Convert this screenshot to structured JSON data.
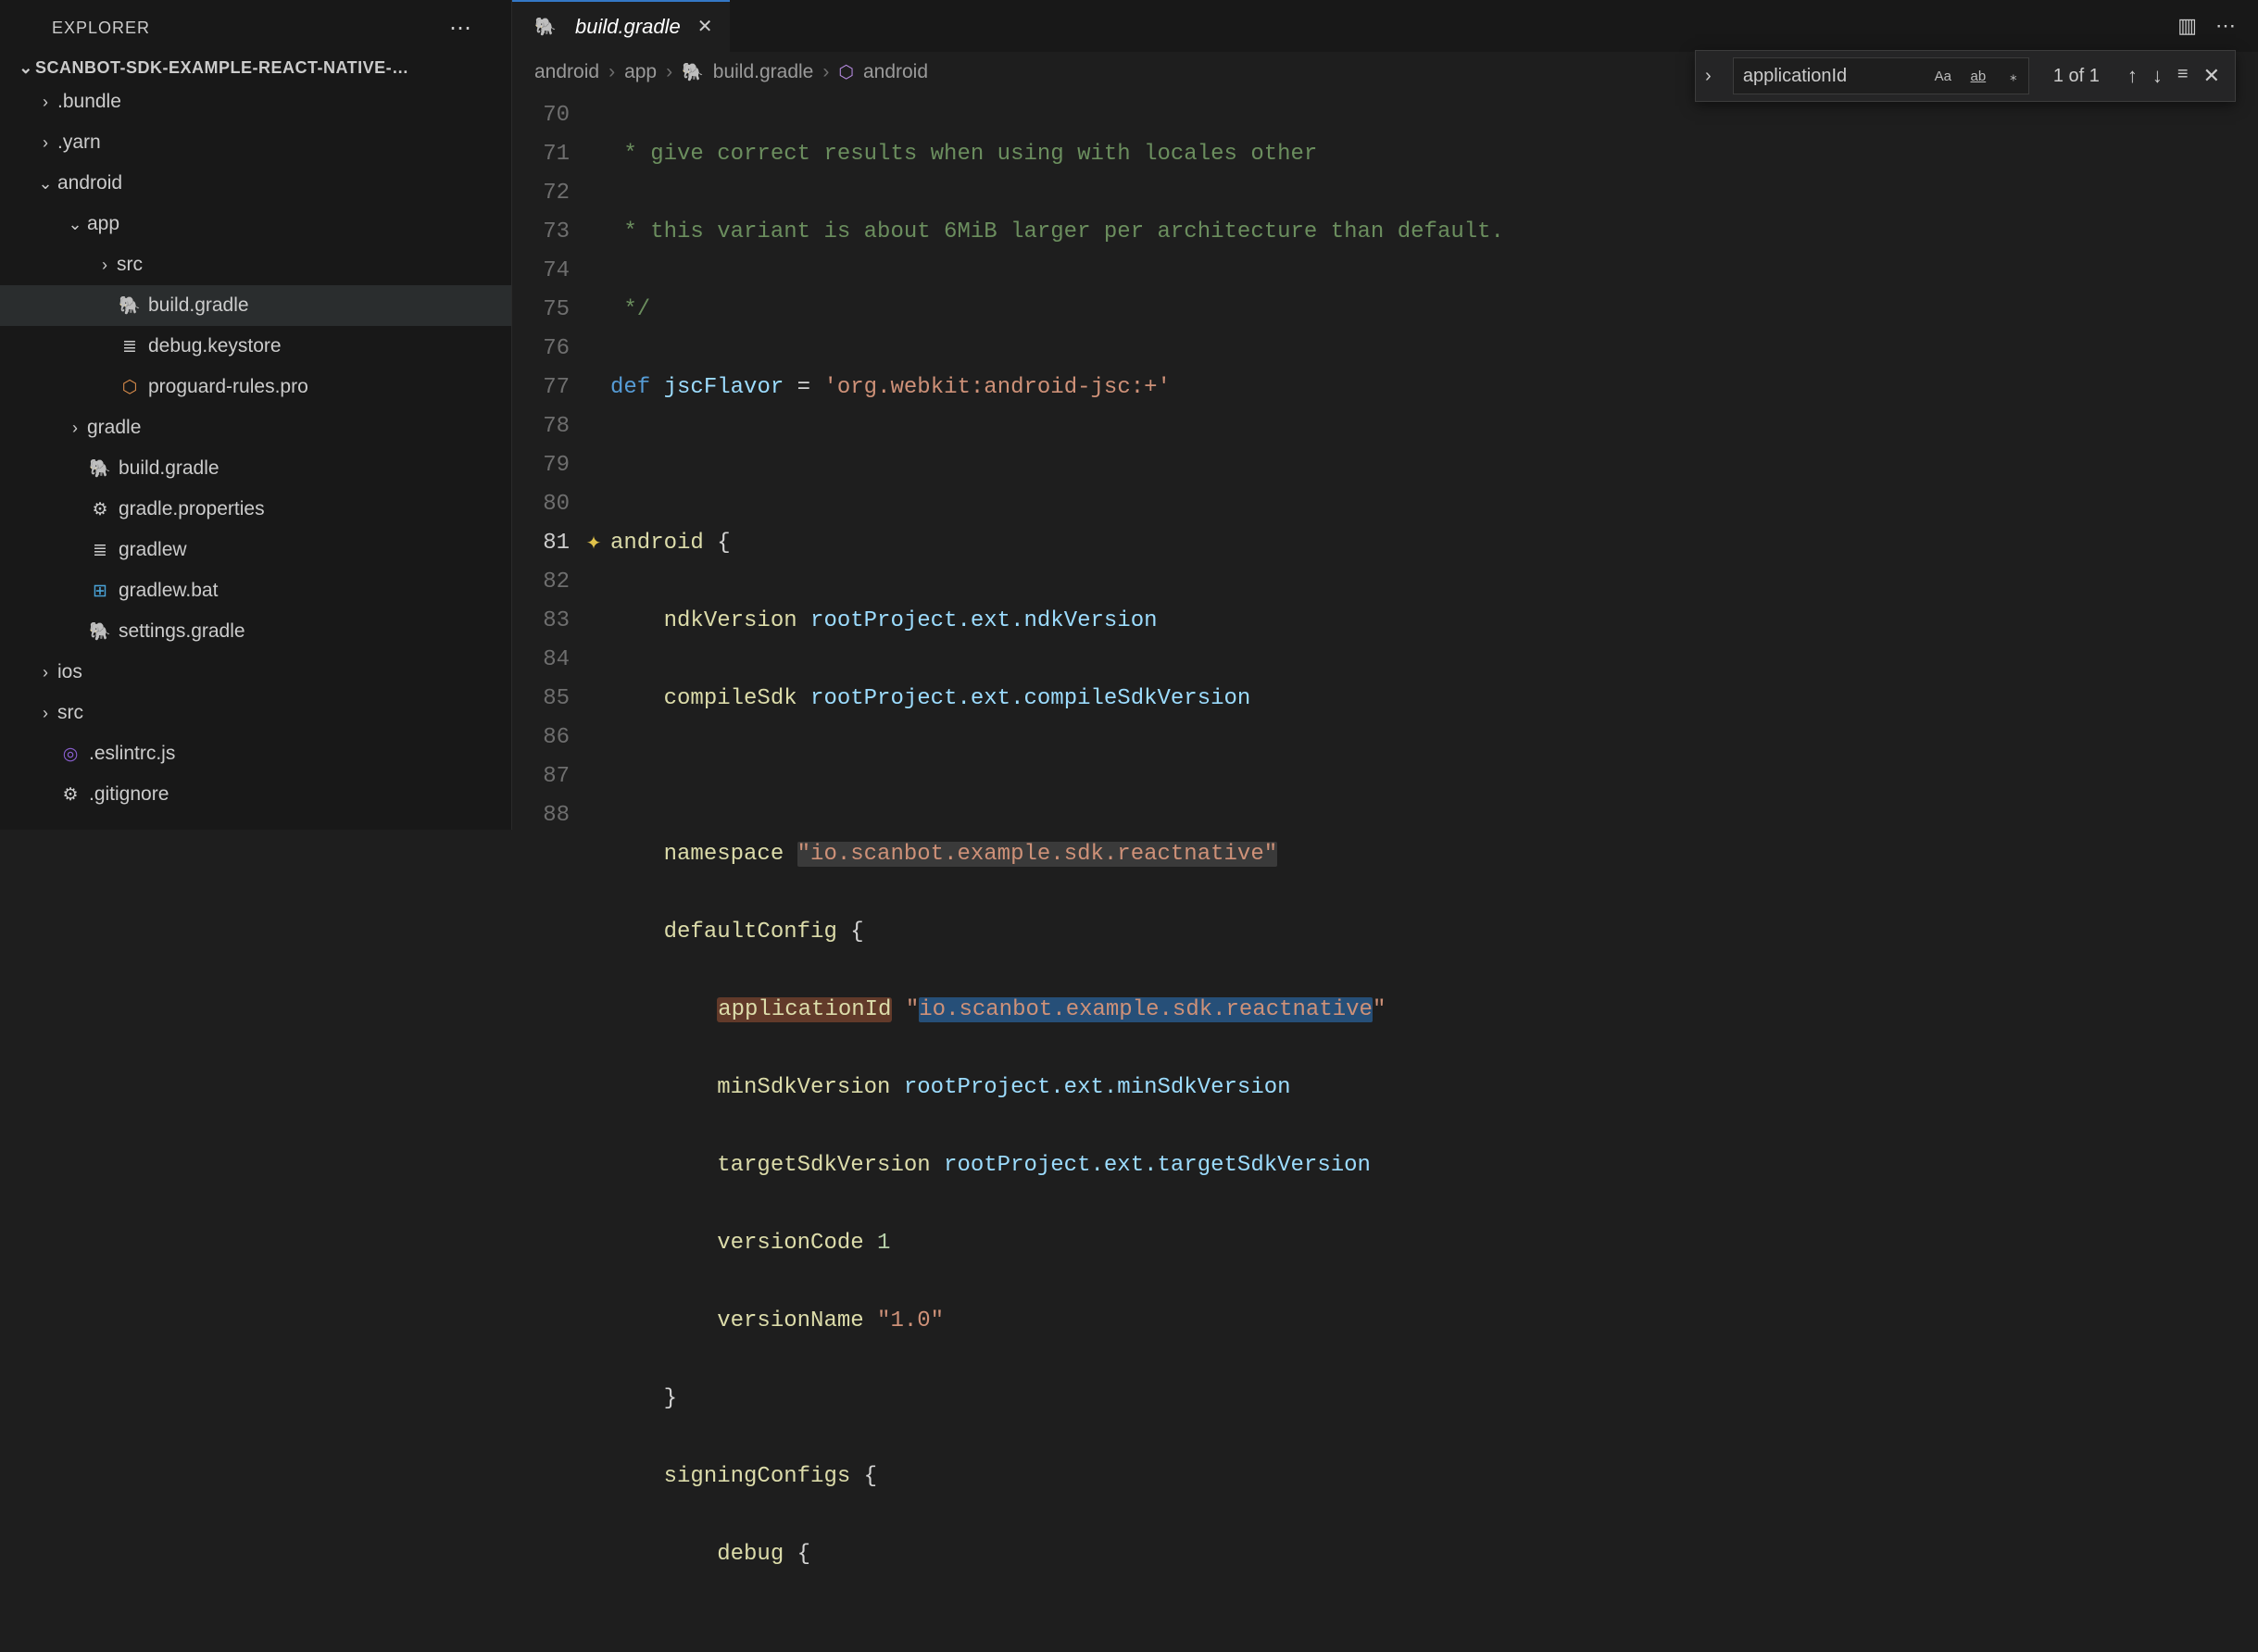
{
  "explorer": {
    "title": "EXPLORER",
    "project": "SCANBOT-SDK-EXAMPLE-REACT-NATIVE-…",
    "tree": [
      {
        "label": ".bundle",
        "depth": 0,
        "chevron": ">",
        "icon": ""
      },
      {
        "label": ".yarn",
        "depth": 0,
        "chevron": ">",
        "icon": ""
      },
      {
        "label": "android",
        "depth": 0,
        "chevron": "v",
        "icon": ""
      },
      {
        "label": "app",
        "depth": 1,
        "chevron": "v",
        "icon": ""
      },
      {
        "label": "src",
        "depth": 2,
        "chevron": ">",
        "icon": ""
      },
      {
        "label": "build.gradle",
        "depth": 2,
        "chevron": "",
        "icon": "gradle",
        "selected": true
      },
      {
        "label": "debug.keystore",
        "depth": 2,
        "chevron": "",
        "icon": "lines"
      },
      {
        "label": "proguard-rules.pro",
        "depth": 2,
        "chevron": "",
        "icon": "shield"
      },
      {
        "label": "gradle",
        "depth": 1,
        "chevron": ">",
        "icon": ""
      },
      {
        "label": "build.gradle",
        "depth": 1,
        "chevron": "",
        "icon": "gradle"
      },
      {
        "label": "gradle.properties",
        "depth": 1,
        "chevron": "",
        "icon": "gear"
      },
      {
        "label": "gradlew",
        "depth": 1,
        "chevron": "",
        "icon": "lines"
      },
      {
        "label": "gradlew.bat",
        "depth": 1,
        "chevron": "",
        "icon": "win"
      },
      {
        "label": "settings.gradle",
        "depth": 1,
        "chevron": "",
        "icon": "gradle"
      },
      {
        "label": "ios",
        "depth": 0,
        "chevron": ">",
        "icon": ""
      },
      {
        "label": "src",
        "depth": 0,
        "chevron": ">",
        "icon": ""
      },
      {
        "label": ".eslintrc.js",
        "depth": 0,
        "chevron": "",
        "icon": "eslint"
      },
      {
        "label": ".gitignore",
        "depth": 0,
        "chevron": "",
        "icon": "gear"
      }
    ]
  },
  "tab": {
    "label": "build.gradle"
  },
  "breadcrumbs": {
    "parts": [
      "android",
      "app",
      "build.gradle",
      "android"
    ]
  },
  "find": {
    "value": "applicationId",
    "count": "1 of 1"
  },
  "editor": {
    "start": 70,
    "active": 81,
    "lines": {
      "l70": " * give correct results when using with locales other",
      "l71": " * this variant is about 6MiB larger per architecture than default.",
      "l72": " */",
      "l73_def": "def",
      "l73_var": " jscFlavor ",
      "l73_eq": "= ",
      "l73_str": "'org.webkit:android-jsc:+'",
      "l75_kw": "android",
      "l75_brace": " {",
      "l76_k": "ndkVersion",
      "l76_v": " rootProject.ext.ndkVersion",
      "l77_k": "compileSdk",
      "l77_v": " rootProject.ext.compileSdkVersion",
      "l79_k": "namespace ",
      "l79_s": "\"io.scanbot.example.sdk.reactnative\"",
      "l80_k": "defaultConfig",
      "l80_b": " {",
      "l81_k": "applicationId",
      "l81_sp": " ",
      "l81_q1": "\"",
      "l81_s": "io.scanbot.example.sdk.reactnative",
      "l81_q2": "\"",
      "l82_k": "minSdkVersion",
      "l82_v": " rootProject.ext.minSdkVersion",
      "l83_k": "targetSdkVersion",
      "l83_v": " rootProject.ext.targetSdkVersion",
      "l84_k": "versionCode ",
      "l84_n": "1",
      "l85_k": "versionName ",
      "l85_s": "\"1.0\"",
      "l86": "}",
      "l87_k": "signingConfigs",
      "l87_b": " {",
      "l88_k": "debug",
      "l88_b": " {"
    }
  },
  "icons": {
    "gradle": "🐘",
    "lines": "≣",
    "gear": "⚙",
    "shield": "⬡",
    "win": "⊞",
    "eslint": "◎",
    "block": "⬡",
    "ellipsis": "⋯",
    "close": "✕",
    "split": "▥",
    "chev_r": "›",
    "chev_d": "⌄",
    "sparkle": "✦",
    "up": "↑",
    "down": "↓",
    "filter": "≡",
    "case": "Aa",
    "word": "ab",
    "regex": "⁎"
  }
}
